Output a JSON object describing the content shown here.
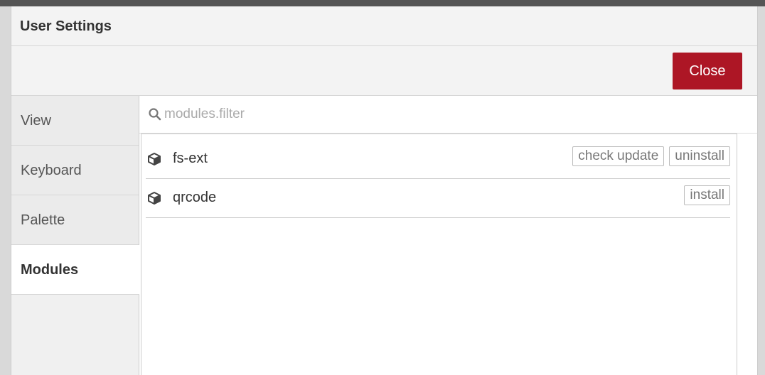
{
  "dialog": {
    "title": "User Settings",
    "close_label": "Close"
  },
  "tabs": [
    {
      "label": "View",
      "active": false
    },
    {
      "label": "Keyboard",
      "active": false
    },
    {
      "label": "Palette",
      "active": false
    },
    {
      "label": "Modules",
      "active": true
    }
  ],
  "modules": {
    "filter_placeholder": "modules.filter",
    "filter_value": "",
    "items": [
      {
        "name": "fs-ext",
        "icon": "cube-icon",
        "actions": [
          "check update",
          "uninstall"
        ]
      },
      {
        "name": "qrcode",
        "icon": "cube-icon",
        "actions": [
          "install"
        ]
      }
    ]
  },
  "colors": {
    "close_button": "#ad1625",
    "header_background": "#f3f3f3",
    "active_tab": "#ffffff"
  }
}
